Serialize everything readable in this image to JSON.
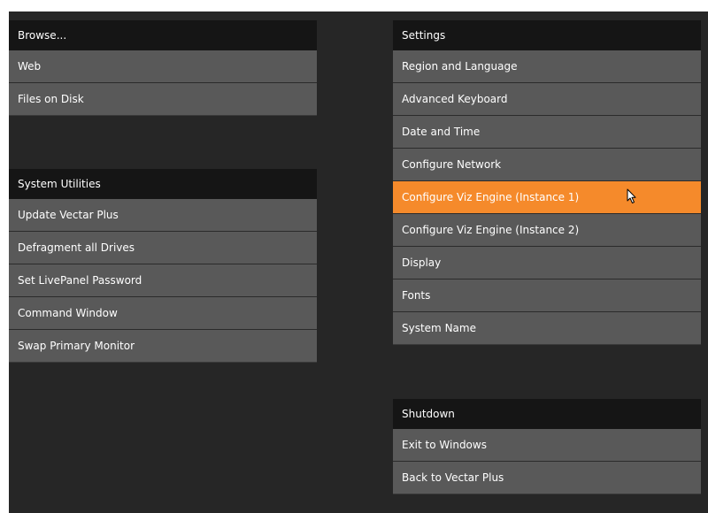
{
  "browse": {
    "header": "Browse...",
    "items": [
      "Web",
      "Files on Disk"
    ]
  },
  "system_utilities": {
    "header": "System Utilities",
    "items": [
      "Update Vectar Plus",
      "Defragment all Drives",
      "Set LivePanel Password",
      "Command Window",
      "Swap Primary Monitor"
    ]
  },
  "settings": {
    "header": "Settings",
    "items": [
      "Region and Language",
      "Advanced Keyboard",
      "Date and Time",
      "Configure Network",
      "Configure Viz Engine (Instance 1)",
      "Configure Viz Engine (Instance 2)",
      "Display",
      "Fonts",
      "System Name"
    ],
    "active_index": 4
  },
  "shutdown": {
    "header": "Shutdown",
    "items": [
      "Exit to Windows",
      "Back to Vectar Plus"
    ]
  },
  "colors": {
    "background": "#262626",
    "header": "#151515",
    "item": "#595959",
    "accent": "#f58a2b"
  },
  "icons": {
    "cursor": "mouse-pointer-icon"
  }
}
